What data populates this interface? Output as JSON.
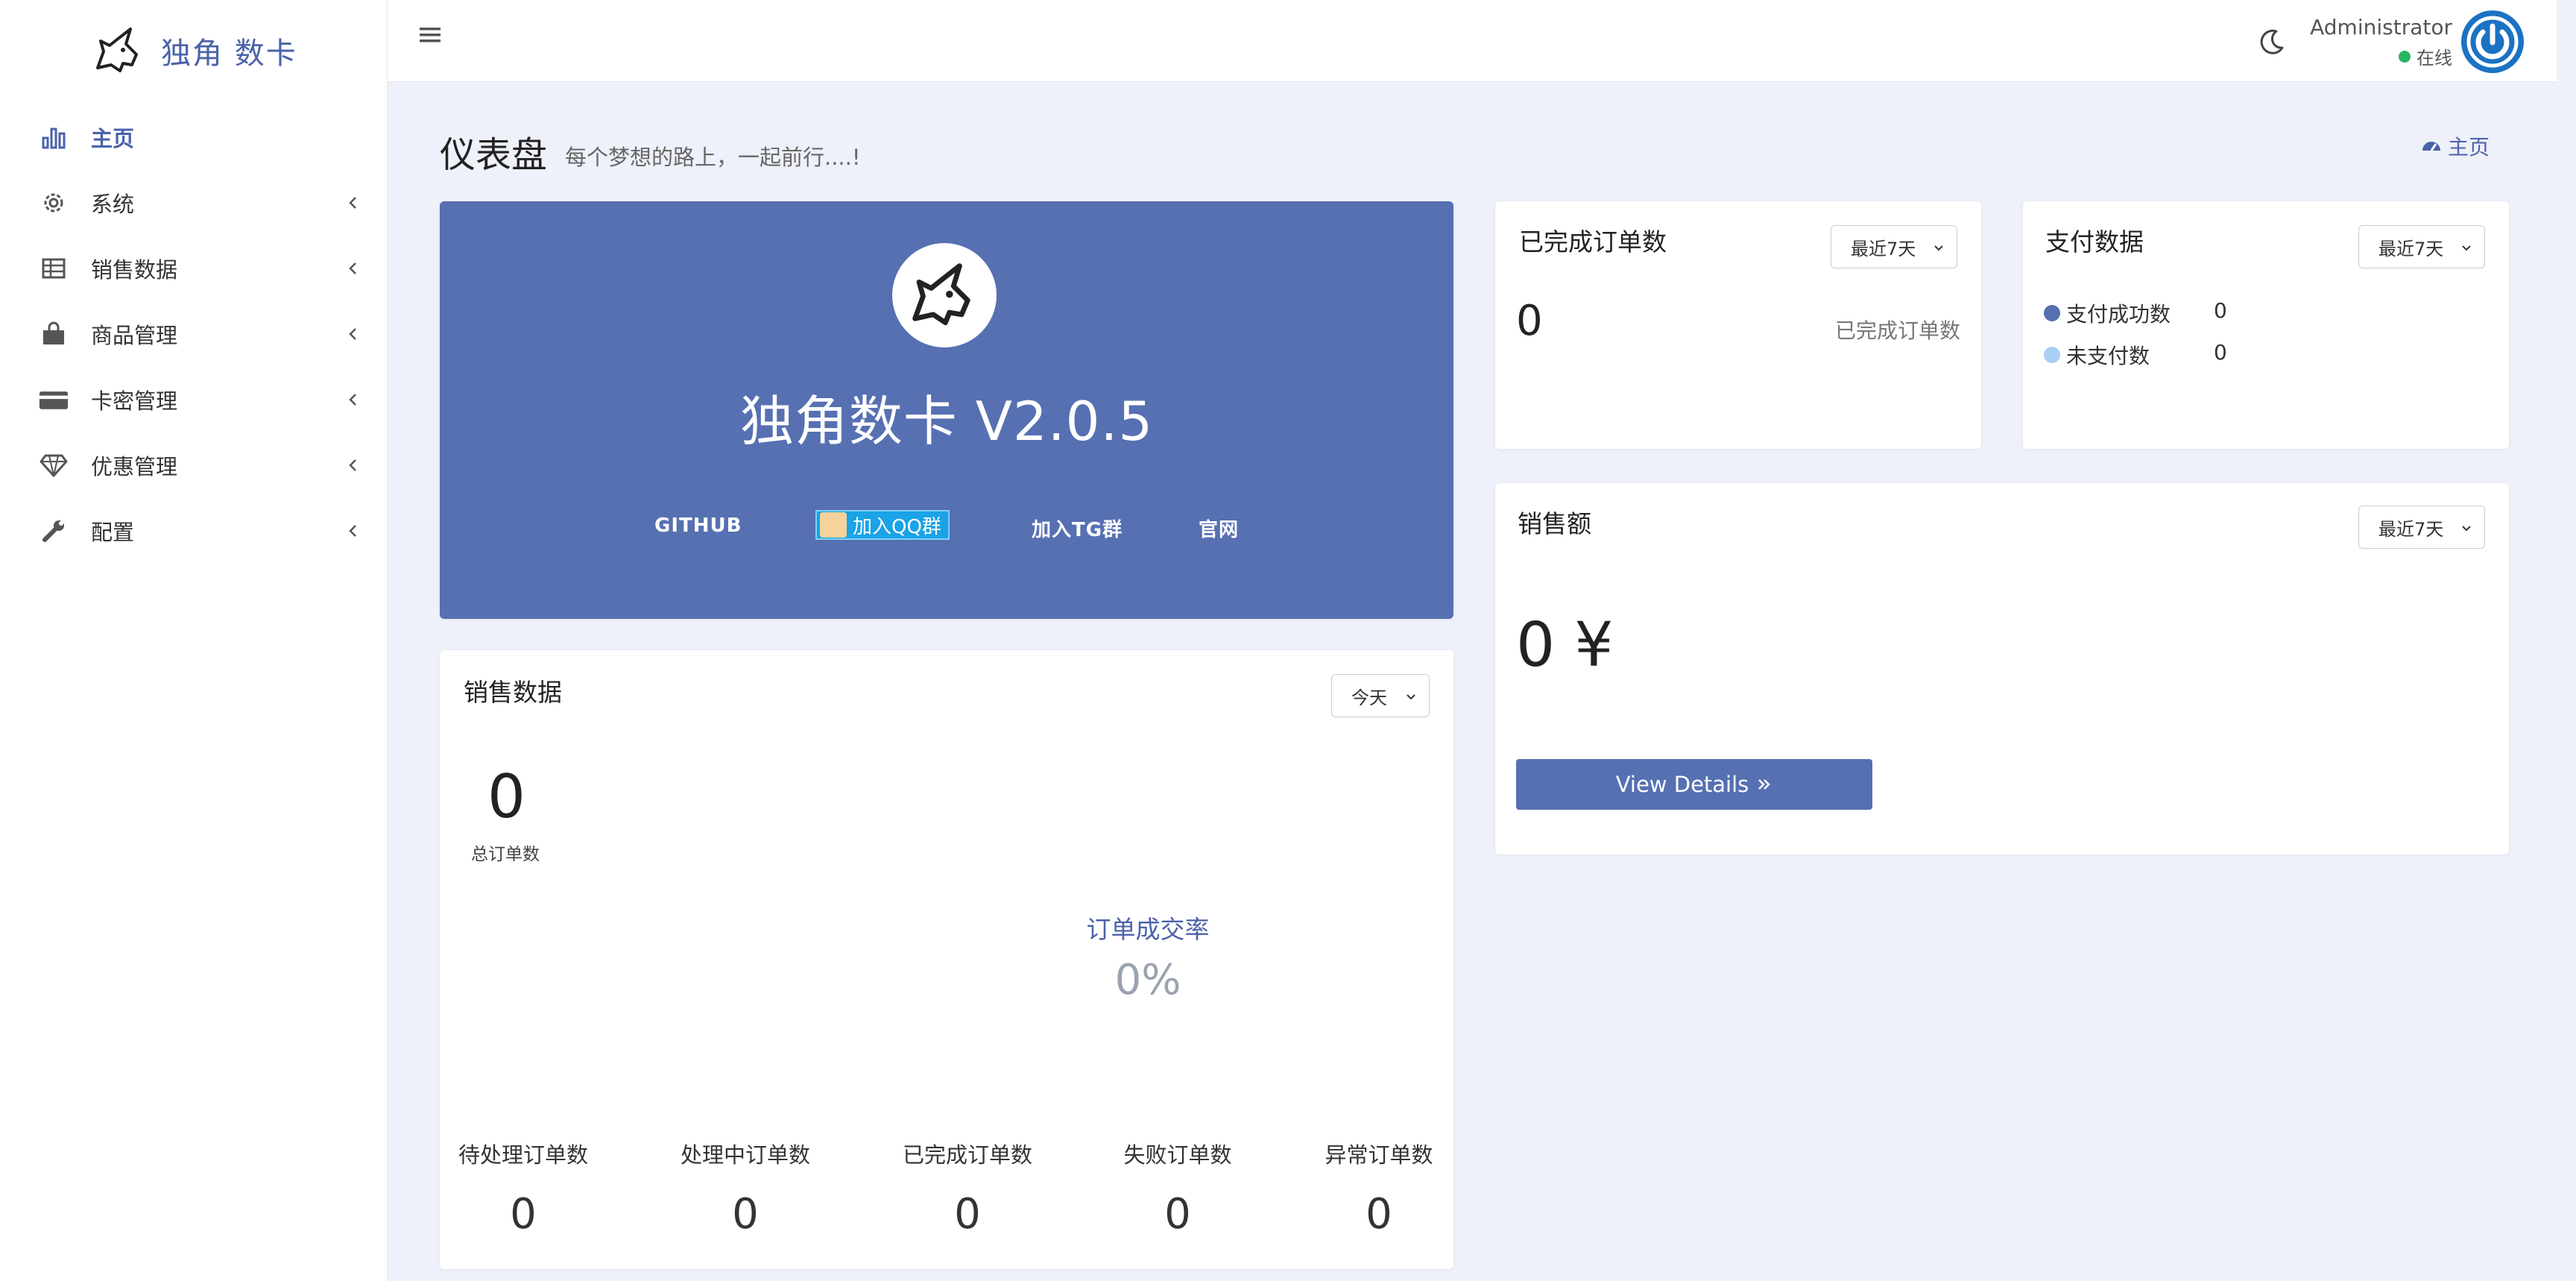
{
  "brand": {
    "name": "独角 数卡"
  },
  "sidebar": {
    "items": [
      {
        "label": "主页",
        "icon": "bar-chart-icon",
        "active": true
      },
      {
        "label": "系统",
        "icon": "gear-icon"
      },
      {
        "label": "销售数据",
        "icon": "table-icon"
      },
      {
        "label": "商品管理",
        "icon": "shopping-bag-icon"
      },
      {
        "label": "卡密管理",
        "icon": "credit-card-icon"
      },
      {
        "label": "优惠管理",
        "icon": "diamond-icon"
      },
      {
        "label": "配置",
        "icon": "wrench-icon"
      }
    ]
  },
  "topbar": {
    "user_name": "Administrator",
    "user_status": "在线",
    "accent": "#1b72c3"
  },
  "page": {
    "title": "仪表盘",
    "subtitle": "每个梦想的路上，一起前行....!",
    "breadcrumb": "主页"
  },
  "hero": {
    "title": "独角数卡 V2.0.5",
    "links": {
      "github": "GITHUB",
      "qq": "加入QQ群",
      "tg": "加入TG群",
      "site": "官网"
    },
    "bg": "#5670b2"
  },
  "sales": {
    "title": "销售数据",
    "period": "今天",
    "total_value": "0",
    "total_label": "总订单数",
    "rate_label": "订单成交率",
    "rate_value": "0%",
    "stats": [
      {
        "label": "待处理订单数",
        "value": "0"
      },
      {
        "label": "处理中订单数",
        "value": "0"
      },
      {
        "label": "已完成订单数",
        "value": "0"
      },
      {
        "label": "失败订单数",
        "value": "0"
      },
      {
        "label": "异常订单数",
        "value": "0"
      }
    ]
  },
  "completed": {
    "title": "已完成订单数",
    "period": "最近7天",
    "value": "0",
    "label": "已完成订单数"
  },
  "payment": {
    "title": "支付数据",
    "period": "最近7天",
    "rows": [
      {
        "label": "支付成功数",
        "value": "0",
        "color": "#5670b2"
      },
      {
        "label": "未支付数",
        "value": "0",
        "color": "#a9cdf5"
      }
    ]
  },
  "revenue": {
    "title": "销售额",
    "period": "最近7天",
    "value": "0 ¥",
    "button": "View Details"
  }
}
